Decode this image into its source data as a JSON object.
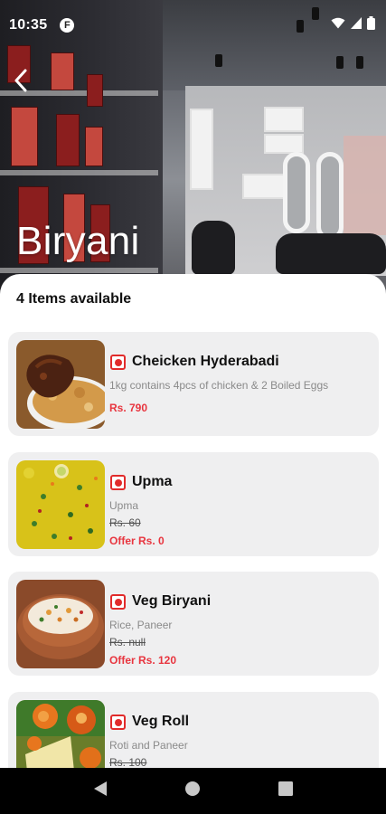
{
  "status_bar": {
    "time": "10:35",
    "app_badge": "F"
  },
  "header": {
    "title": "Biryani"
  },
  "content": {
    "items_count_label": "4 Items available",
    "items": [
      {
        "name": "Cheicken Hyderabadi",
        "description": "1kg contains 4pcs of chicken & 2 Boiled Eggs",
        "price": "Rs. 790"
      },
      {
        "name": "Upma",
        "description": "Upma",
        "original_price": "Rs. 60",
        "offer_price": "Offer Rs. 0"
      },
      {
        "name": "Veg Biryani",
        "description": "Rice, Paneer",
        "original_price": "Rs. null",
        "offer_price": "Offer Rs. 120"
      },
      {
        "name": "Veg Roll",
        "description": "Roti and Paneer",
        "original_price": "Rs. 100"
      }
    ]
  },
  "colors": {
    "accent_red": "#e8353f",
    "veg_mark_red": "#e12b2b",
    "card_bg": "#efeff0"
  },
  "icons": {
    "back": "chevron-left-icon",
    "wifi": "wifi-icon",
    "signal": "signal-icon",
    "battery": "battery-icon",
    "nav_back": "triangle-back-icon",
    "nav_home": "circle-home-icon",
    "nav_recents": "square-recents-icon"
  }
}
